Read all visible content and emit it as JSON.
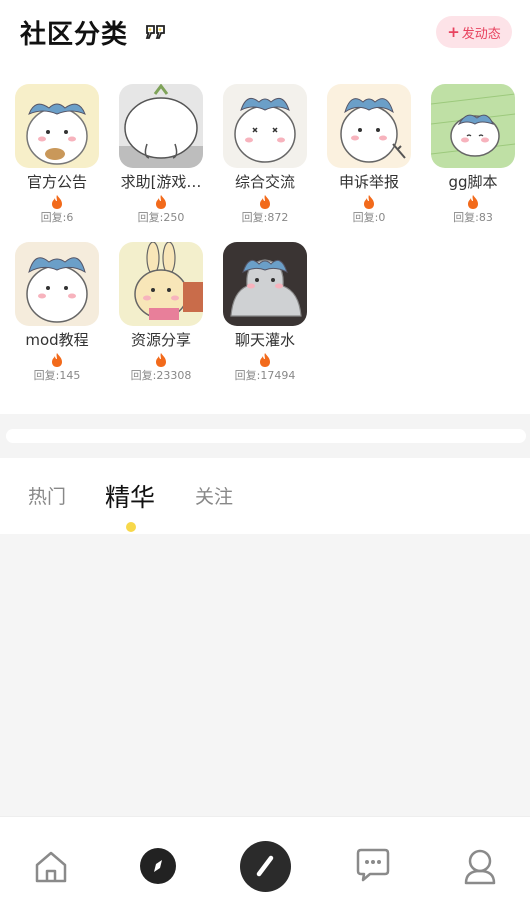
{
  "header": {
    "title": "社区分类",
    "post_button": {
      "icon": "plus-icon",
      "label": "发动态"
    }
  },
  "categories": [
    {
      "name": "官方公告",
      "reply_label": "回复:6",
      "avatar_bg": "#f7efc9"
    },
    {
      "name": "求助[游戏…",
      "reply_label": "回复:250",
      "avatar_bg": "#d8d8d8"
    },
    {
      "name": "综合交流",
      "reply_label": "回复:872",
      "avatar_bg": "#f3f1ec"
    },
    {
      "name": "申诉举报",
      "reply_label": "回复:0",
      "avatar_bg": "#fbf1df"
    },
    {
      "name": "gg脚本",
      "reply_label": "回复:83",
      "avatar_bg": "#bfe0a5"
    },
    {
      "name": "mod教程",
      "reply_label": "回复:145",
      "avatar_bg": "#f5ecdc"
    },
    {
      "name": "资源分享",
      "reply_label": "回复:23308",
      "avatar_bg": "#f3efcc"
    },
    {
      "name": "聊天灌水",
      "reply_label": "回复:17494",
      "avatar_bg": "#3a3433"
    }
  ],
  "tabs": [
    {
      "label": "热门",
      "active": false
    },
    {
      "label": "精华",
      "active": true
    },
    {
      "label": "关注",
      "active": false
    }
  ],
  "bottom_nav": [
    {
      "name": "home",
      "icon": "home-icon"
    },
    {
      "name": "discover",
      "icon": "compass-icon"
    },
    {
      "name": "publish",
      "icon": "pen-icon"
    },
    {
      "name": "messages",
      "icon": "chat-bubble-icon"
    },
    {
      "name": "profile",
      "icon": "user-icon"
    }
  ],
  "colors": {
    "accent_pink": "#e8435f",
    "tab_indicator": "#f7d84a",
    "fire": "#f26a1b"
  }
}
